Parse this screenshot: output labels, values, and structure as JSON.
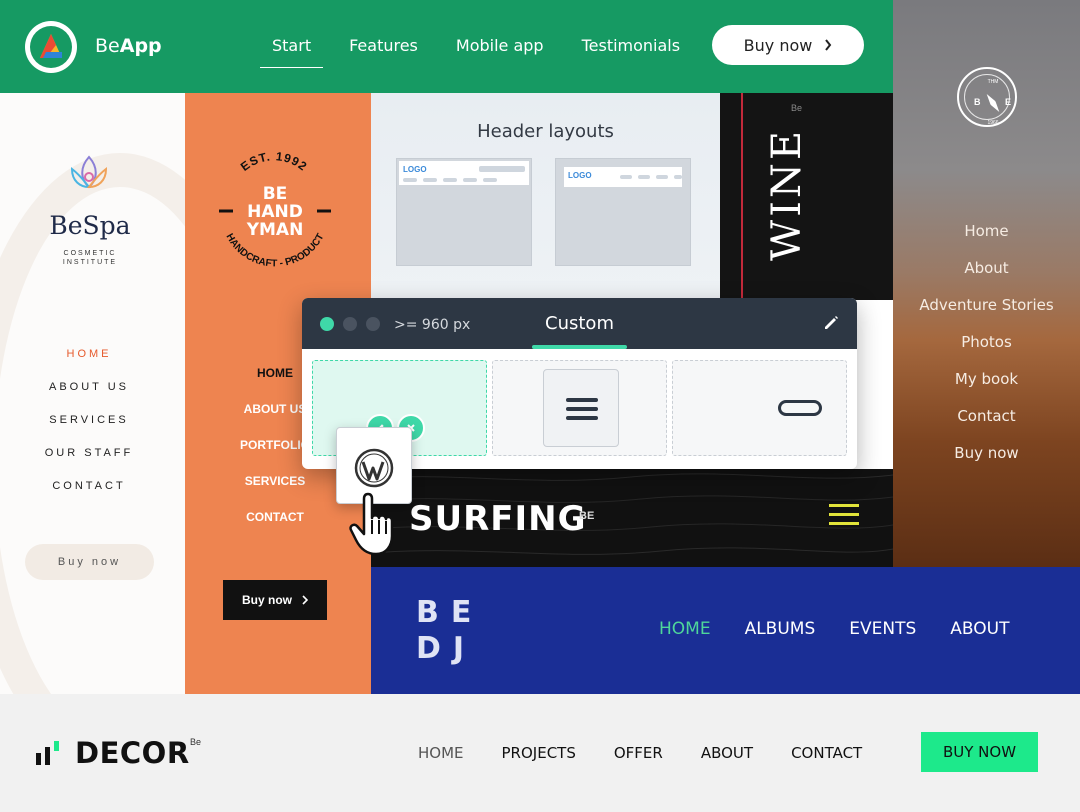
{
  "beapp": {
    "brand_prefix": "Be",
    "brand_bold": "App",
    "nav": [
      "Start",
      "Features",
      "Mobile app",
      "Testimonials"
    ],
    "buy_label": "Buy now",
    "colors": {
      "background": "#169a63"
    }
  },
  "adventure": {
    "compass": {
      "top": "THM",
      "left": "B",
      "right": "E",
      "bottom": "1966"
    },
    "menu": [
      "Home",
      "About",
      "Adventure Stories",
      "Photos",
      "My book",
      "Contact",
      "Buy now"
    ]
  },
  "bespa": {
    "name": "BeSpa",
    "subtitle_line1": "COSMETIC",
    "subtitle_line2": "INSTITUTE",
    "menu": [
      "HOME",
      "ABOUT US",
      "SERVICES",
      "OUR STAFF",
      "CONTACT"
    ],
    "buy_label": "Buy now",
    "colors": {
      "accent": "#e65a2c"
    }
  },
  "handyman": {
    "est": "EST. 1992",
    "name_line1": "BE",
    "name_line2": "HAND",
    "name_line3": "YMAN",
    "tagline": "HANDCRAFT - PRODUCT",
    "menu": [
      "HOME",
      "ABOUT US",
      "PORTFOLIO",
      "SERVICES",
      "CONTACT"
    ],
    "buy_label": "Buy now",
    "colors": {
      "background": "#ee8450"
    }
  },
  "layouts": {
    "title": "Header layouts",
    "card_logo": "LOGO"
  },
  "wine": {
    "be": "Be",
    "word": "WINE"
  },
  "builder": {
    "breakpoint": ">= 960 px",
    "title": "Custom"
  },
  "surfing": {
    "word": "SURFING",
    "be": "BE"
  },
  "dj": {
    "logo_line1": "BE",
    "logo_line2": "DJ",
    "nav": [
      "HOME",
      "ALBUMS",
      "EVENTS",
      "ABOUT"
    ],
    "colors": {
      "background": "#1a2e95",
      "active": "#4fd69a"
    }
  },
  "decor": {
    "logo": "DECOR",
    "be": "Be",
    "nav": [
      "HOME",
      "PROJECTS",
      "OFFER",
      "ABOUT",
      "CONTACT"
    ],
    "buy_label": "BUY NOW",
    "colors": {
      "button": "#1de98b"
    }
  },
  "icons": [
    "chevron-right-icon",
    "compass-icon",
    "lotus-icon",
    "pencil-icon",
    "close-icon",
    "hamburger-icon",
    "wordpress-icon",
    "hand-cursor-icon"
  ]
}
